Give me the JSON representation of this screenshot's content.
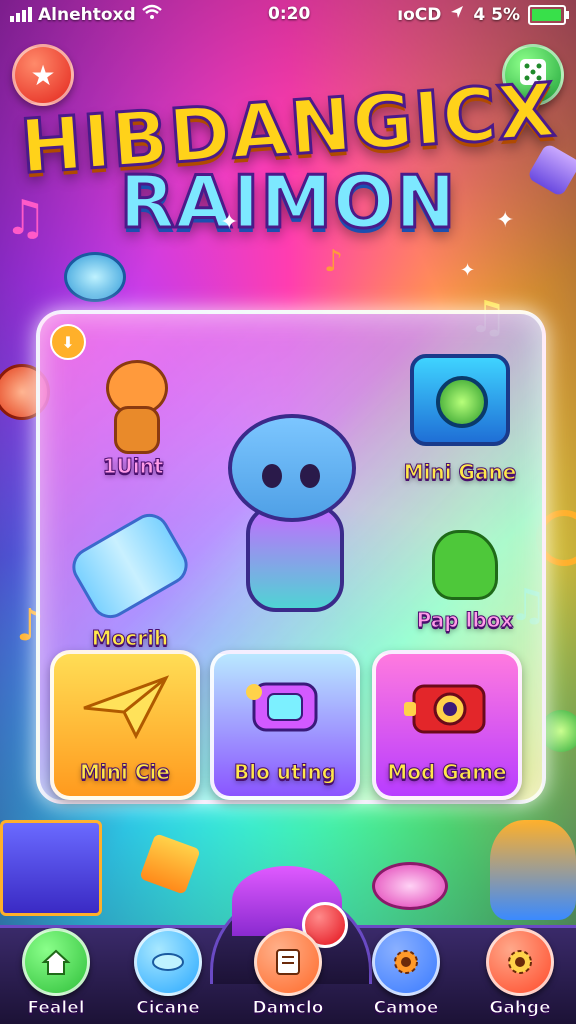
{
  "status_bar": {
    "carrier": "Alnehtoxd",
    "time": "0:20",
    "right_text": "ıoCD",
    "battery": "4 5%",
    "battery_level": 0.85
  },
  "title": {
    "line1": "HIBDANGICX",
    "line2": "RAIMON"
  },
  "panel": {
    "tiles": [
      {
        "label": "1Uint"
      },
      {
        "label": "Mini Gane"
      },
      {
        "label": "Mocrih"
      },
      {
        "label": "Pap lbox"
      }
    ],
    "cards": [
      {
        "label": "Mini Cie"
      },
      {
        "label": "Blo uting"
      },
      {
        "label": "Mod Game"
      }
    ]
  },
  "nav": {
    "items": [
      {
        "label": "Fealel",
        "icon": "home-icon",
        "color": "#2fbf3a"
      },
      {
        "label": "Cicane",
        "icon": "disc-icon",
        "color": "#29a8ff"
      },
      {
        "label": "Damclo",
        "icon": "notes-icon",
        "color": "#ff6a2a"
      },
      {
        "label": "Camoe",
        "icon": "gear-icon",
        "color": "#3a7bff"
      },
      {
        "label": "Gahge",
        "icon": "gear-icon",
        "color": "#ff4a2a"
      }
    ]
  },
  "colors": {
    "title_primary": "#ffd21a",
    "title_secondary": "#7de8ff",
    "nav_bg": "#1c1236"
  }
}
